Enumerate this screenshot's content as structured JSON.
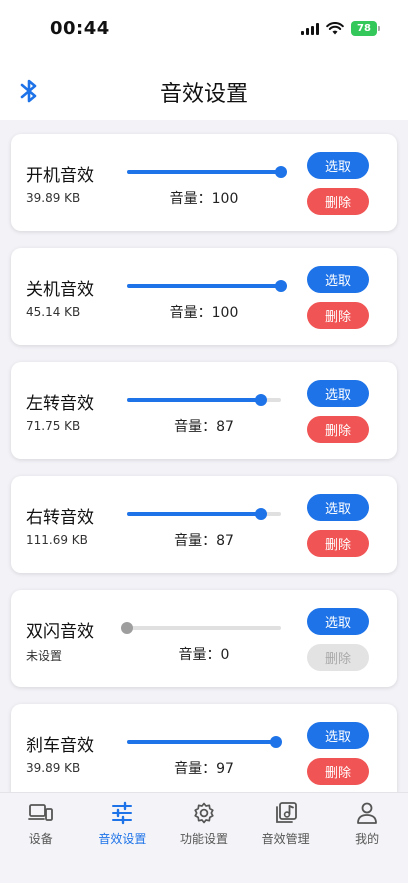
{
  "status_bar": {
    "time": "00:44",
    "battery": "78"
  },
  "header": {
    "title": "音效设置"
  },
  "volume_prefix": "音量：",
  "cards": [
    {
      "name": "开机音效",
      "size": "39.89 KB",
      "volume": "100",
      "level": 1.0,
      "select_label": "选取",
      "delete_label": "删除",
      "delete_enabled": true
    },
    {
      "name": "关机音效",
      "size": "45.14 KB",
      "volume": "100",
      "level": 1.0,
      "select_label": "选取",
      "delete_label": "删除",
      "delete_enabled": true
    },
    {
      "name": "左转音效",
      "size": "71.75 KB",
      "volume": "87",
      "level": 0.87,
      "select_label": "选取",
      "delete_label": "删除",
      "delete_enabled": true
    },
    {
      "name": "右转音效",
      "size": "111.69 KB",
      "volume": "87",
      "level": 0.87,
      "select_label": "选取",
      "delete_label": "删除",
      "delete_enabled": true
    },
    {
      "name": "双闪音效",
      "size": "未设置",
      "volume": "0",
      "level": 0.0,
      "select_label": "选取",
      "delete_label": "删除",
      "delete_enabled": false
    },
    {
      "name": "刹车音效",
      "size": "39.89 KB",
      "volume": "97",
      "level": 0.97,
      "select_label": "选取",
      "delete_label": "删除",
      "delete_enabled": true
    }
  ],
  "tabs": [
    {
      "label": "设备",
      "icon": "devices-icon",
      "active": false
    },
    {
      "label": "音效设置",
      "icon": "sliders-icon",
      "active": true
    },
    {
      "label": "功能设置",
      "icon": "gear-icon",
      "active": false
    },
    {
      "label": "音效管理",
      "icon": "music-library-icon",
      "active": false
    },
    {
      "label": "我的",
      "icon": "person-icon",
      "active": false
    }
  ],
  "colors": {
    "accent": "#1e73e8",
    "danger": "#f05454",
    "battery": "#34c759"
  }
}
